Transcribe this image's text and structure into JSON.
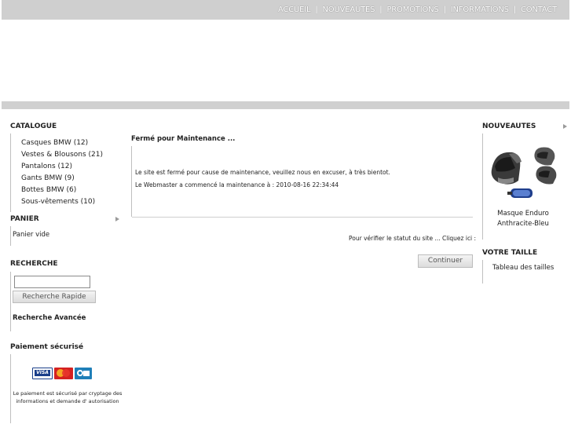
{
  "nav": {
    "items": [
      "ACCUEIL",
      "NOUVEAUTES",
      "PROMOTIONS",
      "INFORMATIONS",
      "CONTACT"
    ]
  },
  "catalogue": {
    "title": "CATALOGUE",
    "items": [
      "Casques BMW (12)",
      "Vestes & Blousons (21)",
      "Pantalons (12)",
      "Gants BMW (9)",
      "Bottes BMW (6)",
      "Sous-vêtements (10)"
    ]
  },
  "cart": {
    "title": "PANIER",
    "empty_text": "Panier vide"
  },
  "search": {
    "title": "RECHERCHE",
    "input_value": "",
    "quick_button": "Recherche Rapide",
    "advanced_link": "Recherche Avancée"
  },
  "payment": {
    "title": "Paiement sécurisé",
    "cards": [
      "VISA",
      "MasterCard",
      "CB"
    ],
    "note": "Le paiement est sécurisé par cryptage des informations et demande d' autorisation"
  },
  "main": {
    "title": "Fermé pour Maintenance ...",
    "line1": "Le site est fermé pour cause de maintenance, veuillez nous en excuser, à très bientot.",
    "line2": "Le Webmaster a commencé la maintenance à : 2010-08-16 22:34:44",
    "status_check": "Pour vérifier le statut du site ... Cliquez ici :",
    "continue_button": "Continuer"
  },
  "new_products": {
    "title": "NOUVEAUTES",
    "product_name": "Masque Enduro Anthracite-Bleu"
  },
  "size": {
    "title": "VOTRE TAILLE",
    "link": "Tableau des tailles"
  },
  "colors": {
    "bar_gray": "#cfcfcf",
    "border_gray": "#bfbfbf",
    "arrow_gray": "#9a9a9a"
  }
}
